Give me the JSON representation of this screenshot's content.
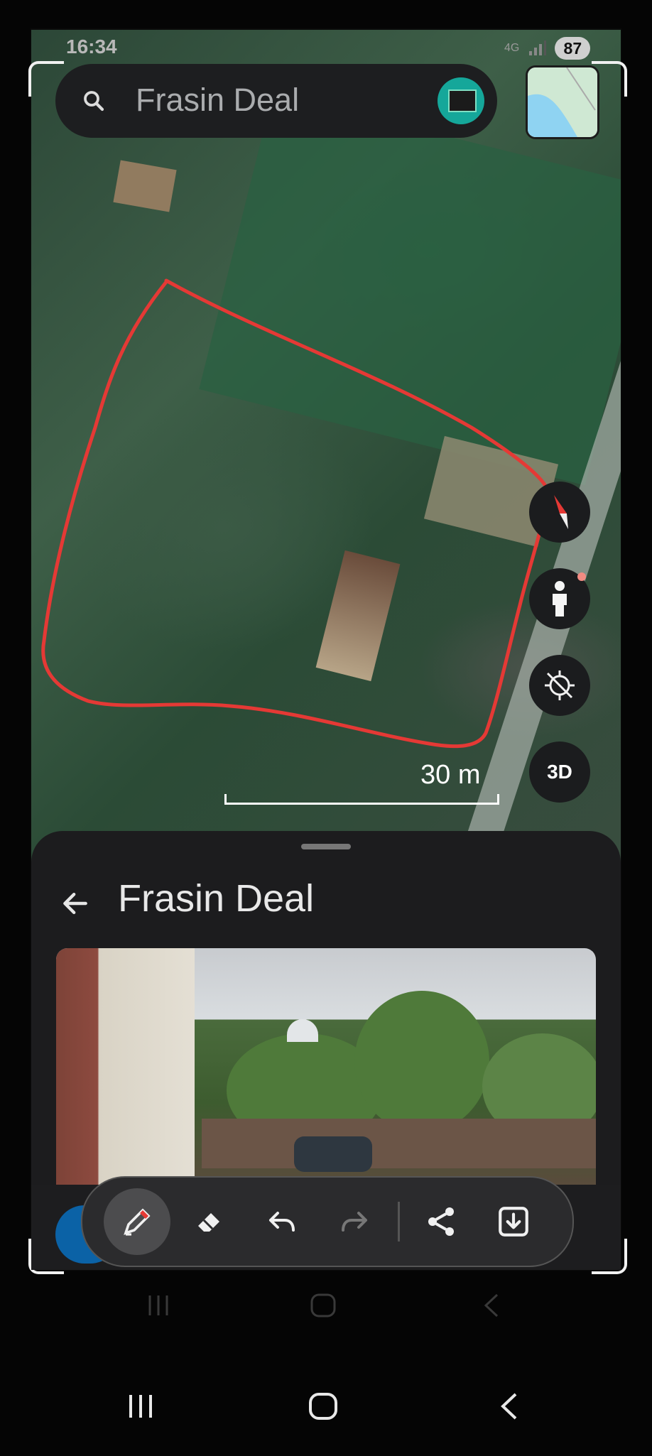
{
  "status_bar": {
    "time": "16:34",
    "network": "4G",
    "battery": "87"
  },
  "search": {
    "query": "Frasin Deal",
    "icon": "search-icon"
  },
  "map": {
    "scale_label": "30 m",
    "buttons": {
      "three_d_label": "3D"
    },
    "annotation_color": "#e53935"
  },
  "sheet": {
    "title": "Frasin Deal"
  },
  "toolbar": {
    "tools": [
      "pen-icon",
      "eraser-icon",
      "undo-icon",
      "redo-icon",
      "share-icon",
      "download-icon"
    ]
  },
  "colors": {
    "accent_blue": "#0b62a6",
    "panel": "#1c1c1e"
  }
}
